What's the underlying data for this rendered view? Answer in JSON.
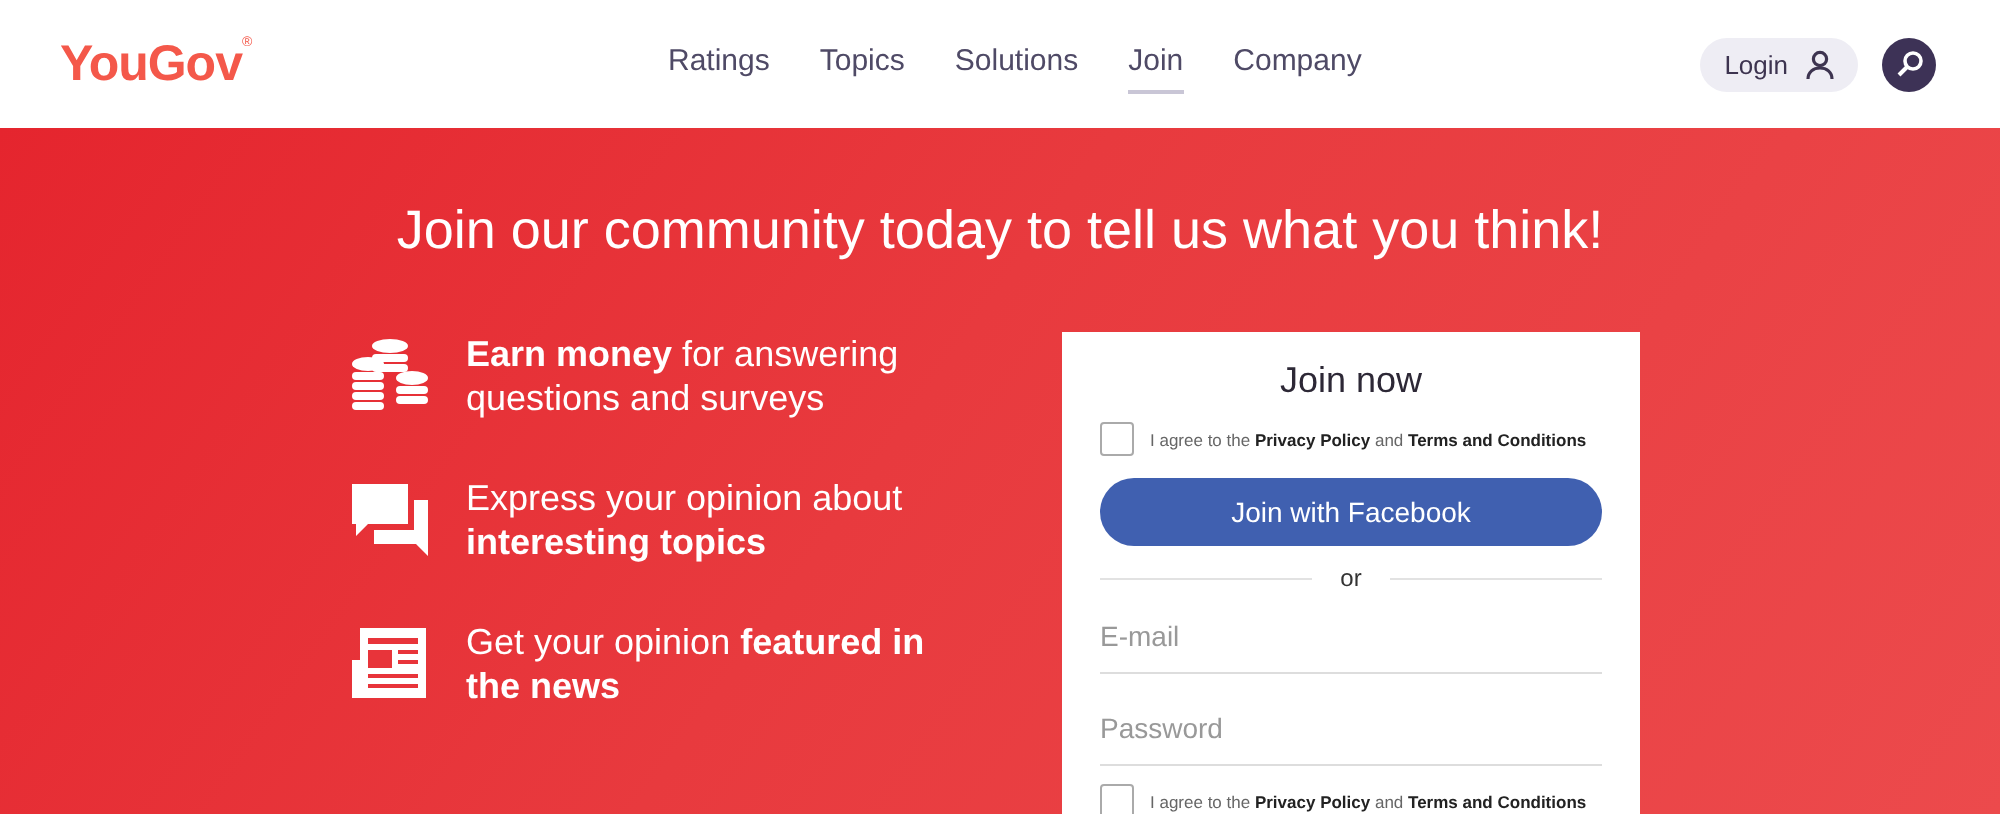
{
  "header": {
    "logo": "YouGov",
    "logo_mark": "®",
    "nav": [
      {
        "label": "Ratings",
        "selected": false
      },
      {
        "label": "Topics",
        "selected": false
      },
      {
        "label": "Solutions",
        "selected": false
      },
      {
        "label": "Join",
        "selected": true
      },
      {
        "label": "Company",
        "selected": false
      }
    ],
    "login": "Login"
  },
  "hero": {
    "title": "Join our community today to tell us what you think!",
    "features": [
      {
        "kind": "coins",
        "text": "**Earn money** for answering questions and surveys"
      },
      {
        "kind": "chat",
        "text": "Express your opinion about **interesting topics**"
      },
      {
        "kind": "news",
        "text": "Get your opinion **featured in the news**"
      }
    ]
  },
  "join_form": {
    "title": "Join now",
    "consent_top": {
      "checked": false,
      "text": "I agree to the **Privacy Policy** and **Terms and Conditions**"
    },
    "facebook_button": "Join with Facebook",
    "divider": "or",
    "email": {
      "placeholder": "E-mail"
    },
    "password": {
      "placeholder": "Password"
    },
    "consent_bottom": {
      "checked": false,
      "text": "I agree to the **Privacy Policy** and **Terms and Conditions**"
    }
  }
}
